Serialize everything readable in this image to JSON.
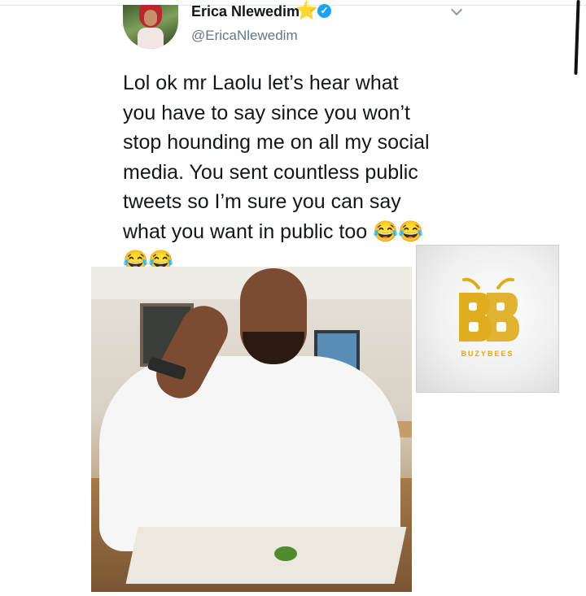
{
  "tweet": {
    "author": {
      "display_name": "Erica Nlewedim",
      "star_emoji": "⭐",
      "handle": "@EricaNlewedim"
    },
    "text": "Lol ok mr Laolu let’s hear what\nyou have to say since you won’t\nstop hounding me on all my social\nmedia. You sent countless public\ntweets so I’m sure you can say\nwhat you want in public too 😂😂\n😂😂"
  },
  "logo": {
    "caption": "BUZYBEES",
    "color": "#e0ad1e"
  },
  "icons": [
    "star-icon",
    "verified-icon",
    "chevron-down-icon"
  ]
}
